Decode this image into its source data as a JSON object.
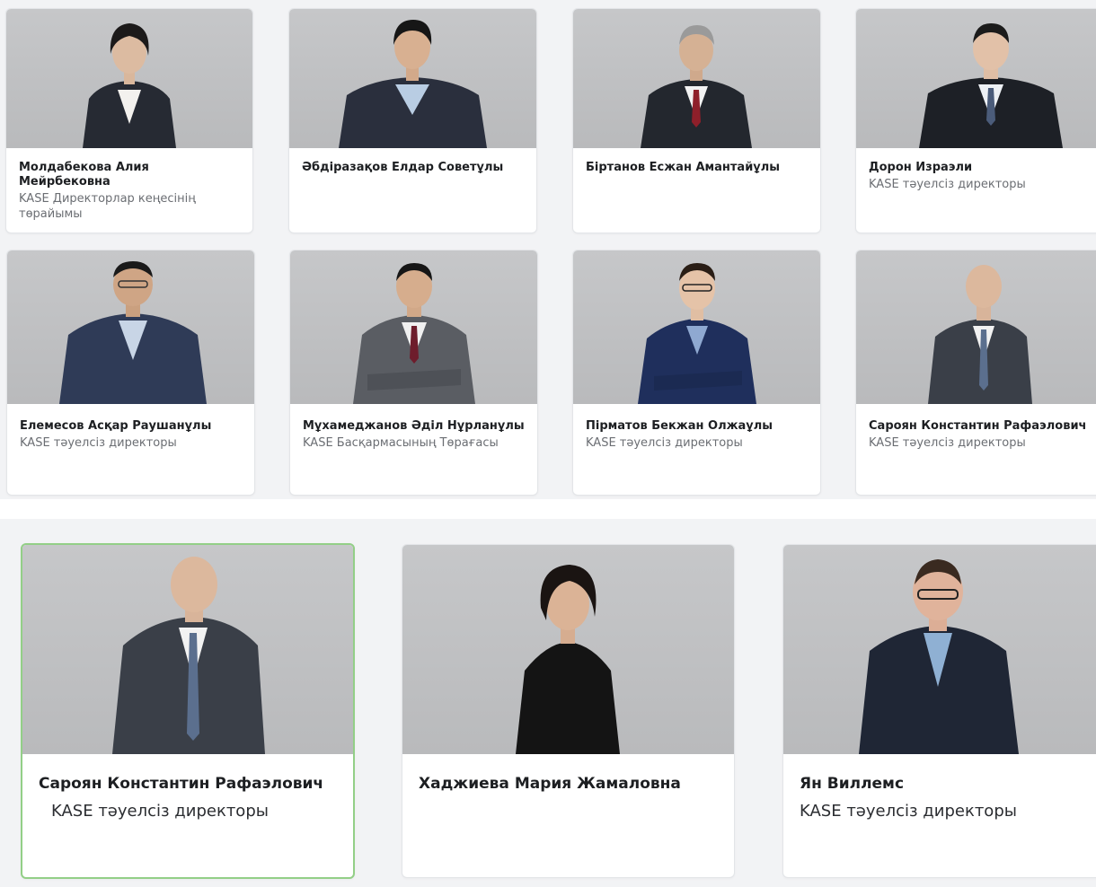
{
  "section_top": {
    "row1": [
      {
        "name": "Молдабекова Алия Мейрбековна",
        "role": "KASE Директорлар кеңесінің төрайымы"
      },
      {
        "name": "Әбдіразақов Елдар Советұлы",
        "role": ""
      },
      {
        "name": "Біртанов Есжан Амантайұлы",
        "role": ""
      },
      {
        "name": "Дорон Израэли",
        "role": "KASE тәуелсіз директоры"
      }
    ],
    "row2": [
      {
        "name": "Елемесов Асқар Раушанұлы",
        "role": "KASE тәуелсіз директоры"
      },
      {
        "name": "Мұхамеджанов Әділ Нұрланұлы",
        "role": "KASE Басқармасының Төрағасы"
      },
      {
        "name": "Пірматов Бекжан Олжаұлы",
        "role": "KASE тәуелсіз директоры"
      },
      {
        "name": "Сароян Константин Рафаэлович",
        "role": "KASE тәуелсіз директоры"
      }
    ]
  },
  "section_bottom": {
    "cards": [
      {
        "name": "Сароян Константин Рафаэлович",
        "role": "KASE тәуелсіз директоры",
        "selected": true
      },
      {
        "name": "Хаджиева Мария Жамаловна",
        "role": "",
        "selected": false
      },
      {
        "name": "Ян Виллемс",
        "role": "KASE тәуелсіз директоры",
        "selected": false
      }
    ]
  },
  "colors": {
    "photo_background": "#c0c1c3",
    "active_border": "#93cf87",
    "name_text": "#1d1f22",
    "role_text": "#6b6e73"
  },
  "icons": {
    "portrait": "person-portrait-photo"
  }
}
